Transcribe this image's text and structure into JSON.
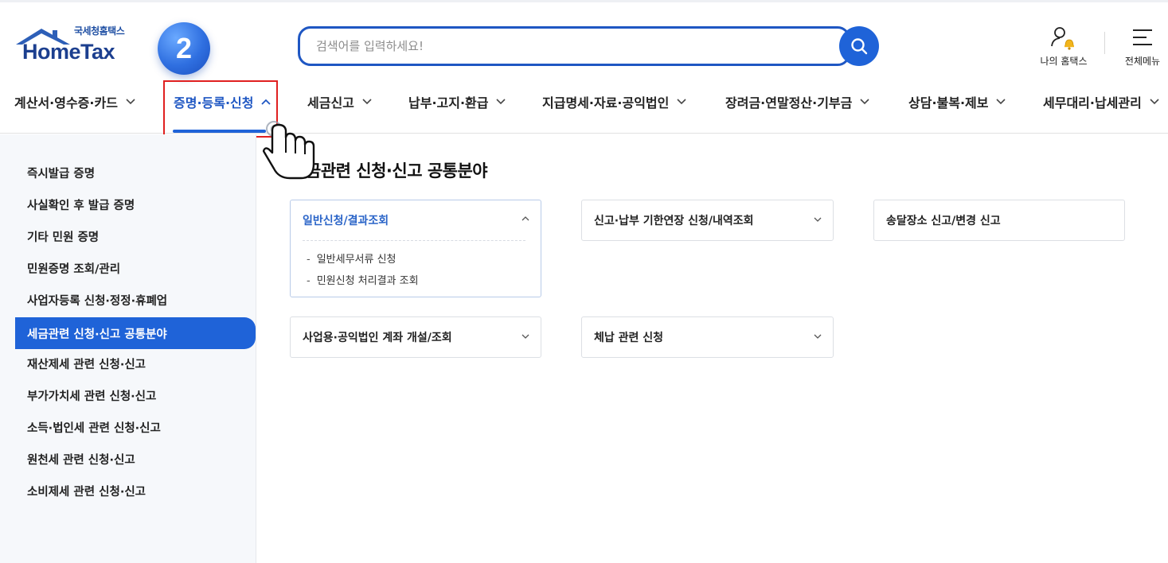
{
  "header": {
    "logo_sub": "국세청홈택스",
    "logo_main": "HomeTax",
    "step_number": "2",
    "search_placeholder": "검색어를 입력하세요!",
    "my_hometax_label": "나의 홈택스",
    "all_menu_label": "전체메뉴",
    "accent_color": "#1f63d8"
  },
  "gnb": {
    "items": [
      {
        "label": "계산서·영수증·카드",
        "active": false
      },
      {
        "label": "증명·등록·신청",
        "active": true
      },
      {
        "label": "세금신고",
        "active": false
      },
      {
        "label": "납부·고지·환급",
        "active": false
      },
      {
        "label": "지급명세·자료·공익법인",
        "active": false
      },
      {
        "label": "장려금·연말정산·기부금",
        "active": false
      },
      {
        "label": "상담·불복·제보",
        "active": false
      },
      {
        "label": "세무대리·납세관리",
        "active": false
      }
    ]
  },
  "sidebar": {
    "items": [
      {
        "label": "즉시발급 증명",
        "active": false
      },
      {
        "label": "사실확인 후 발급 증명",
        "active": false
      },
      {
        "label": "기타 민원 증명",
        "active": false
      },
      {
        "label": "민원증명 조회/관리",
        "active": false
      },
      {
        "label": "사업자등록 신청·정정·휴폐업",
        "active": false
      },
      {
        "label": "세금관련 신청·신고 공통분야",
        "active": true
      },
      {
        "label": "재산제세 관련 신청·신고",
        "active": false
      },
      {
        "label": "부가가치세 관련 신청·신고",
        "active": false
      },
      {
        "label": "소득·법인세 관련 신청·신고",
        "active": false
      },
      {
        "label": "원천세 관련 신청·신고",
        "active": false
      },
      {
        "label": "소비제세 관련 신청·신고",
        "active": false
      }
    ]
  },
  "main": {
    "title": "금관련 신청·신고 공통분야",
    "cards": [
      {
        "title": "일반신청/결과조회",
        "expanded": true,
        "sub_items": [
          "일반세무서류 신청",
          "민원신청 처리결과 조회"
        ]
      },
      {
        "title": "신고·납부 기한연장 신청/내역조회",
        "expanded": false
      },
      {
        "title": "송달장소 신고/변경 신고",
        "expanded": false
      },
      {
        "title": "사업용·공익법인 계좌 개설/조회",
        "expanded": false
      },
      {
        "title": "체납 관련 신청",
        "expanded": false
      }
    ]
  }
}
